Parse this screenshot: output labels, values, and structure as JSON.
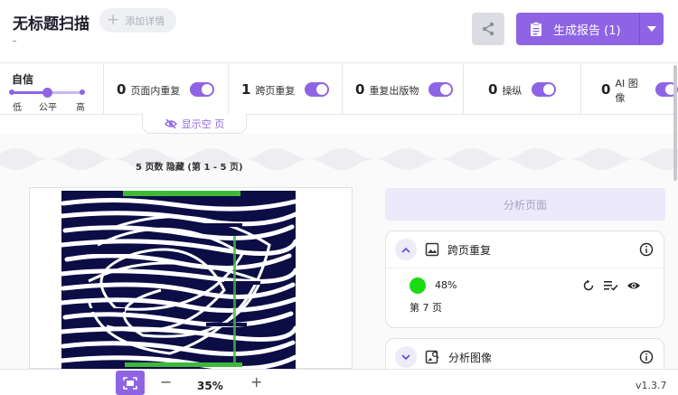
{
  "header": {
    "title": "无标题扫描",
    "add_detail_label": "添加详情",
    "report_label": "生成报告 (1)"
  },
  "confidence": {
    "label": "自信",
    "low": "低",
    "mid": "公平",
    "high": "高",
    "level": 0.5
  },
  "stats": [
    {
      "count": "0",
      "label": "页面内重复",
      "enabled": true
    },
    {
      "count": "1",
      "label": "跨页重复",
      "enabled": true
    },
    {
      "count": "0",
      "label": "重复出版物",
      "enabled": true
    },
    {
      "count": "0",
      "label": "操纵",
      "enabled": true
    },
    {
      "count": "0",
      "label": "AI 图像",
      "enabled": true
    }
  ],
  "show_empty_label": "显示空 页",
  "page_count_label": "5 页数 隐藏 (第 1 - 5 页)",
  "analysis": {
    "analyze_page_label": "分析页面",
    "cross_page": {
      "title": "跨页重复",
      "match_percent": "48%",
      "match_page": "第 7 页",
      "match_color": "#1bdc12"
    },
    "image_analysis": {
      "title": "分析图像"
    }
  },
  "zoom": {
    "minus": "−",
    "value": "35%",
    "plus": "+"
  },
  "version": "v1.3.7",
  "colors": {
    "accent": "#8f64e4",
    "accent_light": "#ece9fa"
  }
}
